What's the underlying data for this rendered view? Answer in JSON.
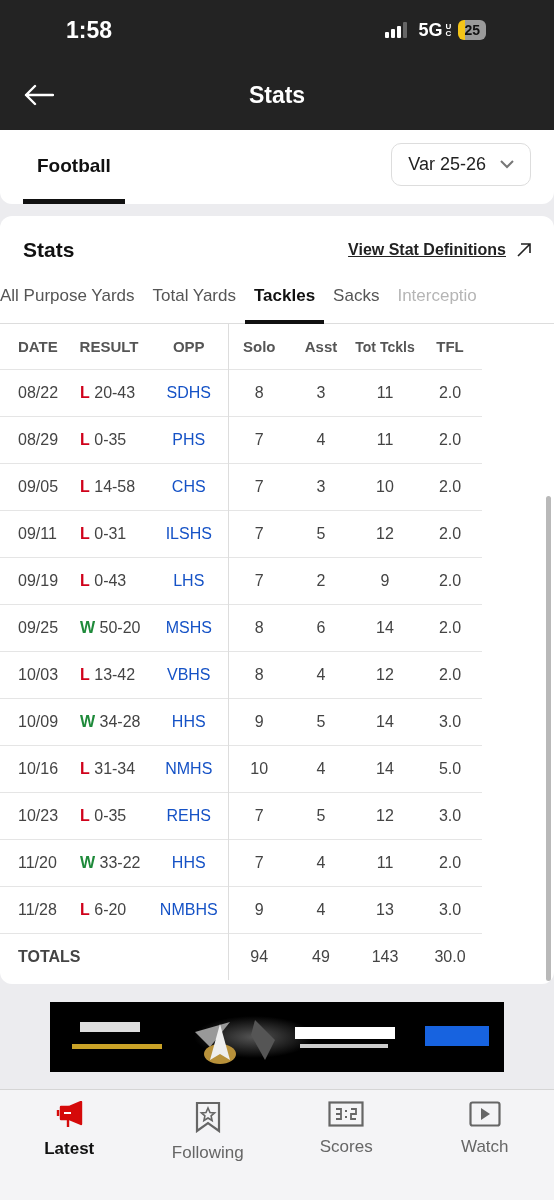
{
  "status_bar": {
    "time": "1:58",
    "network": "5G",
    "network_suffix": "UC",
    "battery": "25"
  },
  "header": {
    "title": "Stats"
  },
  "sport_tabs": [
    {
      "label": "Football",
      "selected": true
    }
  ],
  "season_dropdown": {
    "value": "Var 25-26"
  },
  "stats_card": {
    "title": "Stats",
    "link": "View Stat Definitions"
  },
  "stat_tabs": [
    {
      "label": "All Purpose Yards",
      "selected": false
    },
    {
      "label": "Total Yards",
      "selected": false
    },
    {
      "label": "Tackles",
      "selected": true
    },
    {
      "label": "Sacks",
      "selected": false
    },
    {
      "label": "Interceptio",
      "selected": false
    }
  ],
  "table": {
    "columns": [
      "DATE",
      "RESULT",
      "OPP",
      "Solo",
      "Asst",
      "Tot Tckls",
      "TFL"
    ],
    "rows": [
      {
        "date": "08/22",
        "outcome": "L",
        "score": "20-43",
        "opp": "SDHS",
        "solo": "8",
        "asst": "3",
        "tot": "11",
        "tfl": "2.0"
      },
      {
        "date": "08/29",
        "outcome": "L",
        "score": "0-35",
        "opp": "PHS",
        "solo": "7",
        "asst": "4",
        "tot": "11",
        "tfl": "2.0"
      },
      {
        "date": "09/05",
        "outcome": "L",
        "score": "14-58",
        "opp": "CHS",
        "solo": "7",
        "asst": "3",
        "tot": "10",
        "tfl": "2.0"
      },
      {
        "date": "09/11",
        "outcome": "L",
        "score": "0-31",
        "opp": "ILSHS",
        "solo": "7",
        "asst": "5",
        "tot": "12",
        "tfl": "2.0"
      },
      {
        "date": "09/19",
        "outcome": "L",
        "score": "0-43",
        "opp": "LHS",
        "solo": "7",
        "asst": "2",
        "tot": "9",
        "tfl": "2.0"
      },
      {
        "date": "09/25",
        "outcome": "W",
        "score": "50-20",
        "opp": "MSHS",
        "solo": "8",
        "asst": "6",
        "tot": "14",
        "tfl": "2.0"
      },
      {
        "date": "10/03",
        "outcome": "L",
        "score": "13-42",
        "opp": "VBHS",
        "solo": "8",
        "asst": "4",
        "tot": "12",
        "tfl": "2.0"
      },
      {
        "date": "10/09",
        "outcome": "W",
        "score": "34-28",
        "opp": "HHS",
        "solo": "9",
        "asst": "5",
        "tot": "14",
        "tfl": "3.0"
      },
      {
        "date": "10/16",
        "outcome": "L",
        "score": "31-34",
        "opp": "NMHS",
        "solo": "10",
        "asst": "4",
        "tot": "14",
        "tfl": "5.0"
      },
      {
        "date": "10/23",
        "outcome": "L",
        "score": "0-35",
        "opp": "REHS",
        "solo": "7",
        "asst": "5",
        "tot": "12",
        "tfl": "3.0"
      },
      {
        "date": "11/20",
        "outcome": "W",
        "score": "33-22",
        "opp": "HHS",
        "solo": "7",
        "asst": "4",
        "tot": "11",
        "tfl": "2.0"
      },
      {
        "date": "11/28",
        "outcome": "L",
        "score": "6-20",
        "opp": "NMBHS",
        "solo": "9",
        "asst": "4",
        "tot": "13",
        "tfl": "3.0"
      }
    ],
    "totals": {
      "label": "TOTALS",
      "solo": "94",
      "asst": "49",
      "tot": "143",
      "tfl": "30.0"
    }
  },
  "bottom_nav": [
    {
      "label": "Latest",
      "kind": "megaphone",
      "selected": true
    },
    {
      "label": "Following",
      "kind": "bookmark",
      "selected": false
    },
    {
      "label": "Scores",
      "kind": "scoreboard",
      "selected": false
    },
    {
      "label": "Watch",
      "kind": "play",
      "selected": false
    }
  ]
}
